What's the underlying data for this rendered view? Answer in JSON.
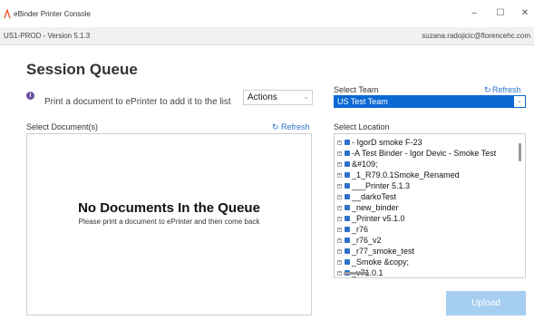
{
  "window": {
    "title": "eBinder Printer Console",
    "controls": {
      "minimize": "–",
      "maximize": "☐",
      "close": "✕"
    }
  },
  "status": {
    "version": "US1-PROD - Version 5.1.3",
    "user": "suzana.radojicic@florencehc.com"
  },
  "page": {
    "title": "Session Queue",
    "info_text": "Print a document to ePrinter to add it to the list"
  },
  "actions": {
    "label": "Actions"
  },
  "documents": {
    "label": "Select Document(s)",
    "refresh": "Refresh",
    "empty_title": "No Documents In the Queue",
    "empty_subtitle": "Please print a document to ePrinter and then come back"
  },
  "team": {
    "label": "Select Team",
    "refresh": "Refresh",
    "selected": "US Test Team"
  },
  "location": {
    "label": "Select Location",
    "items": [
      "- IgorD smoke F-23",
      "-A Test Binder - Igor Devic - Smoke Test",
      "&#109;",
      "_1_R79.0.1Smoke_Renamed",
      "___Printer 5.1.3",
      "__darkoTest",
      "_new_binder",
      "_Printer v5.1.0",
      "_r76",
      "_r76_v2",
      "_r77_smoke_test",
      "_Smoke &copy;",
      "_v71.0.1"
    ]
  },
  "upload": {
    "label": "Upload"
  },
  "colors": {
    "accent": "#0b69d4",
    "link": "#2c72c8",
    "upload_disabled": "#a6cef1",
    "info_icon": "#6b4fa0"
  },
  "icons": {
    "app": "ebinder-app-icon",
    "info": "info-icon",
    "refresh": "refresh-icon",
    "chevron": "chevron-down-icon",
    "tree_toggle": "tree-expand-icon",
    "tree_node": "binder-icon"
  }
}
